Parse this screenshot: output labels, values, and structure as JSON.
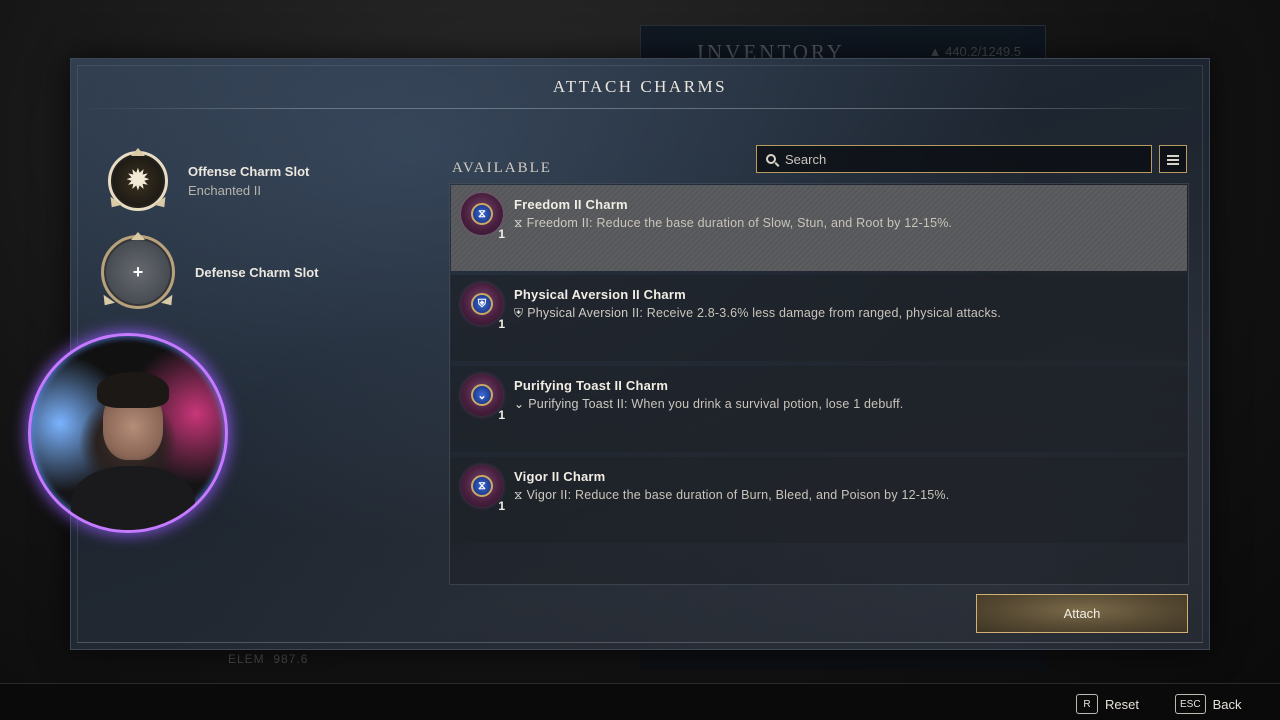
{
  "background": {
    "inventory_title": "INVENTORY",
    "inventory_weight": "440.2/1249.5",
    "elem_label": "ELEM",
    "elem_value": "987.6"
  },
  "modal": {
    "title": "ATTACH CHARMS"
  },
  "slots": [
    {
      "name": "Offense Charm Slot",
      "sub": "Enchanted II",
      "icon": "starburst-charm-icon"
    },
    {
      "name": "Defense Charm Slot",
      "sub": "",
      "icon": "plus-icon",
      "symbol": "+"
    }
  ],
  "available": {
    "label": "AVAILABLE",
    "search_placeholder": "Search",
    "items": [
      {
        "name": "Freedom II Charm",
        "perk_name": "Freedom II:",
        "description": "Reduce the base duration of Slow, Stun, and Root by 12-15%.",
        "count": "1",
        "perk_icon": "hourglass-icon",
        "gem_symbol": "⧖"
      },
      {
        "name": "Physical Aversion II Charm",
        "perk_name": "Physical Aversion II:",
        "description": "Receive 2.8-3.6% less damage from ranged, physical attacks.",
        "count": "1",
        "perk_icon": "shield-icon",
        "gem_symbol": "⛨"
      },
      {
        "name": "Purifying Toast II Charm",
        "perk_name": "Purifying Toast II:",
        "description": "When you drink a survival potion, lose 1 debuff.",
        "count": "1",
        "perk_icon": "chevron-down-icon",
        "gem_symbol": "⌄"
      },
      {
        "name": "Vigor II Charm",
        "perk_name": "Vigor II:",
        "description": "Reduce the base duration of Burn, Bleed, and Poison by 12-15%.",
        "count": "1",
        "perk_icon": "hourglass-icon",
        "gem_symbol": "⧖"
      }
    ],
    "selected_index": 0
  },
  "attach_label": "Attach",
  "footer": {
    "reset_key": "R",
    "reset_label": "Reset",
    "back_key": "ESC",
    "back_label": "Back"
  },
  "colors": {
    "accent_gold": "#d1b074",
    "webcam_ring": "#c67aff"
  }
}
